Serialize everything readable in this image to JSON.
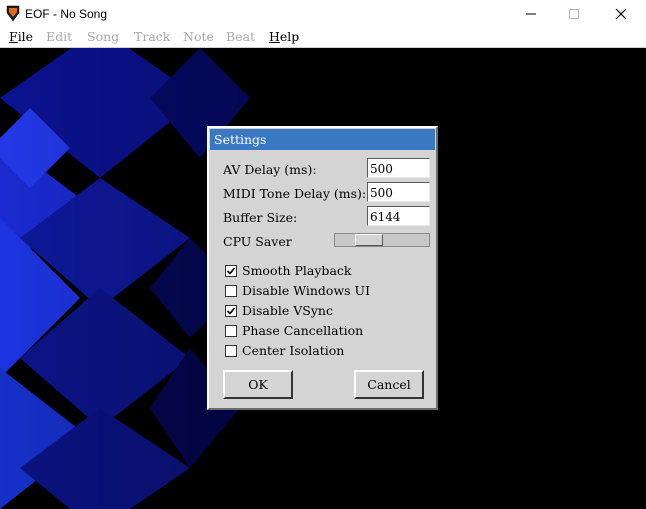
{
  "window": {
    "title": "EOF - No Song",
    "icon": "guitar-pick-icon"
  },
  "menubar": {
    "items": [
      {
        "label": "File",
        "enabled": true
      },
      {
        "label": "Edit",
        "enabled": false
      },
      {
        "label": "Song",
        "enabled": false
      },
      {
        "label": "Track",
        "enabled": false
      },
      {
        "label": "Note",
        "enabled": false
      },
      {
        "label": "Beat",
        "enabled": false
      },
      {
        "label": "Help",
        "enabled": true
      }
    ]
  },
  "settings": {
    "title": "Settings",
    "fields": [
      {
        "label": "AV Delay (ms):",
        "value": "500"
      },
      {
        "label": "MIDI Tone Delay (ms):",
        "value": "500"
      },
      {
        "label": "Buffer Size:",
        "value": "6144"
      }
    ],
    "cpu_saver": {
      "label": "CPU Saver",
      "level": 0.3
    },
    "checkboxes": [
      {
        "label": "Smooth Playback",
        "checked": true
      },
      {
        "label": "Disable Windows UI",
        "checked": false
      },
      {
        "label": "Disable VSync",
        "checked": true
      },
      {
        "label": "Phase Cancellation",
        "checked": false
      },
      {
        "label": "Center Isolation",
        "checked": false
      }
    ],
    "ok_label": "OK",
    "cancel_label": "Cancel"
  },
  "colors": {
    "dialog_title_bg": "#3a78c4",
    "background_blue": "#0a1a8a"
  }
}
